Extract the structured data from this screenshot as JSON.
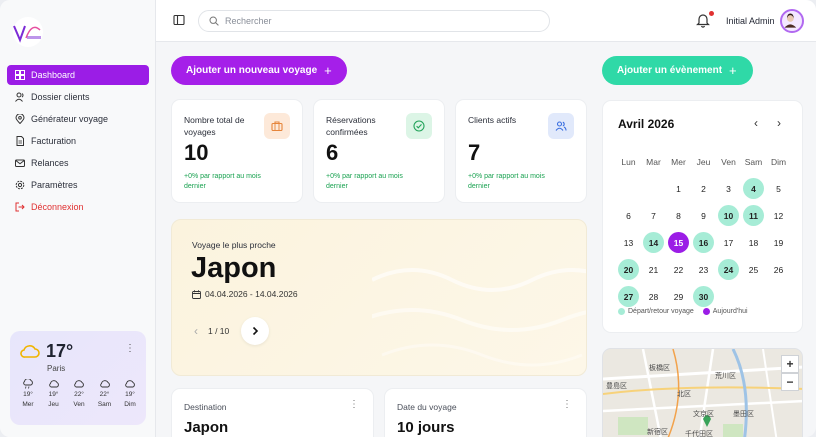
{
  "sidebar": {
    "items": [
      {
        "label": "Dashboard"
      },
      {
        "label": "Dossier clients"
      },
      {
        "label": "Générateur voyage"
      },
      {
        "label": "Facturation"
      },
      {
        "label": "Relances"
      },
      {
        "label": "Paramètres"
      },
      {
        "label": "Déconnexion"
      }
    ]
  },
  "weather": {
    "temp": "17°",
    "city": "Paris",
    "forecast": [
      {
        "temp": "19°",
        "day": "Mer",
        "icon": "rain-icon"
      },
      {
        "temp": "19°",
        "day": "Jeu",
        "icon": "cloud-icon"
      },
      {
        "temp": "22°",
        "day": "Ven",
        "icon": "cloud-icon"
      },
      {
        "temp": "22°",
        "day": "Sam",
        "icon": "cloud-icon"
      },
      {
        "temp": "19°",
        "day": "Dim",
        "icon": "cloud-icon"
      }
    ]
  },
  "header": {
    "search_placeholder": "Rechercher",
    "user_name": "Initial Admin"
  },
  "actions": {
    "new_trip": "Ajouter un nouveau voyage",
    "new_event": "Ajouter un évènement"
  },
  "stats": [
    {
      "label": "Nombre total de voyages",
      "value": "10",
      "sub": "+0% par rapport au mois dernier",
      "icon": "suitcase-icon",
      "color": "#fde9d9"
    },
    {
      "label": "Réservations confirmées",
      "value": "6",
      "sub": "+0% par rapport au mois dernier",
      "icon": "check-circle-icon",
      "color": "#dcf5e6"
    },
    {
      "label": "Clients actifs",
      "value": "7",
      "sub": "+0% par rapport au mois dernier",
      "icon": "users-icon",
      "color": "#e1e9fb"
    }
  ],
  "next_trip": {
    "kicker": "Voyage le plus proche",
    "title": "Japon",
    "dates": "04.04.2026 - 14.04.2026",
    "pager": "1 / 10"
  },
  "info_cards": [
    {
      "label": "Destination",
      "value": "Japon"
    },
    {
      "label": "Date du voyage",
      "value": "10 jours"
    }
  ],
  "calendar": {
    "title": "Avril 2026",
    "weekdays": [
      "Lun",
      "Mar",
      "Mer",
      "Jeu",
      "Ven",
      "Sam",
      "Dim"
    ],
    "weeks": [
      [
        "",
        "",
        "1",
        "2",
        "3",
        "4",
        "5"
      ],
      [
        "6",
        "7",
        "8",
        "9",
        "10",
        "11",
        "12"
      ],
      [
        "13",
        "14",
        "15",
        "16",
        "17",
        "18",
        "19"
      ],
      [
        "20",
        "21",
        "22",
        "23",
        "24",
        "25",
        "26"
      ],
      [
        "27",
        "28",
        "29",
        "30",
        "",
        "",
        ""
      ]
    ],
    "event_days": [
      "4",
      "10",
      "11",
      "14",
      "16",
      "20",
      "24",
      "27",
      "30"
    ],
    "today": "15",
    "legend_event": "Départ/retour voyage",
    "legend_today": "Aujourd'hui",
    "event_color": "#a6ecd6",
    "today_color": "#9b1de6"
  },
  "map": {
    "labels": [
      "板橋区",
      "荒川区",
      "北区",
      "豊島区",
      "文京区",
      "墨田区",
      "新宿区",
      "千代田区"
    ],
    "zoom_in": "+",
    "zoom_out": "−"
  }
}
